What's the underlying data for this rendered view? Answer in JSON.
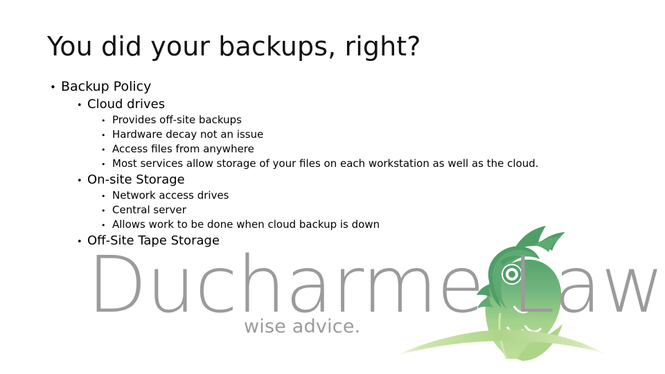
{
  "slide": {
    "title": "You did your backups, right?",
    "background_color": "#ffffff",
    "text_color": "#000000",
    "bullet_glyph": "•",
    "content": [
      {
        "level": 1,
        "text": "Backup Policy"
      },
      {
        "level": 2,
        "text": "Cloud drives"
      },
      {
        "level": 3,
        "text": "Provides off-site backups"
      },
      {
        "level": 3,
        "text": "Hardware decay not an issue"
      },
      {
        "level": 3,
        "text": "Access files from anywhere"
      },
      {
        "level": 3,
        "text": "Most services allow storage of your files on each workstation as well as the cloud."
      },
      {
        "level": 2,
        "text": "On-site Storage"
      },
      {
        "level": 3,
        "text": "Network access drives"
      },
      {
        "level": 3,
        "text": "Central server"
      },
      {
        "level": 3,
        "text": "Allows work to be done when cloud backup is down"
      },
      {
        "level": 2,
        "text": "Off-Site Tape Storage"
      }
    ]
  },
  "logo": {
    "wordmark_part1": "Ducharme",
    "wordmark_part2": "Law",
    "tagline": "wise advice.",
    "text_color": "#9b9b9b",
    "bird_color_top": "#5faa72",
    "bird_color_bottom": "#b7da90",
    "hill_color": "#b7da90"
  }
}
